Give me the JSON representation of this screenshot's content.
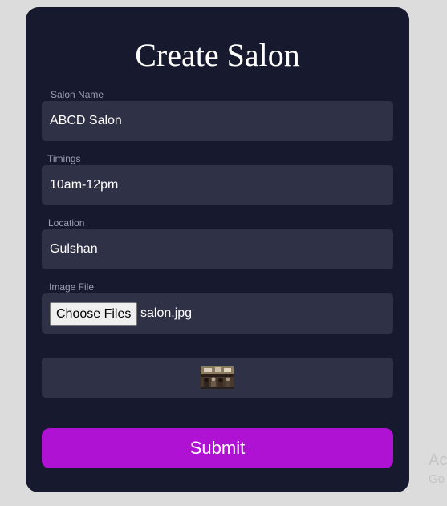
{
  "form": {
    "title": "Create Salon",
    "fields": [
      {
        "label": "Salon Name",
        "value": "ABCD Salon"
      },
      {
        "label": "Timings",
        "value": "10am-12pm"
      },
      {
        "label": "Location",
        "value": "Gulshan"
      }
    ],
    "image_file": {
      "label": "Image File",
      "button_label": "Choose Files",
      "file_name": "salon.jpg"
    },
    "preview": {
      "icon": "salon-photo-thumbnail"
    },
    "submit_label": "Submit"
  },
  "watermark": {
    "line1": "Ac",
    "line2": "Go"
  },
  "colors": {
    "page_background": "#dcdcdc",
    "card_background": "#171a2e",
    "field_background": "#2f3146",
    "label_text": "#9b9fb5",
    "submit_background": "#b012d4"
  }
}
